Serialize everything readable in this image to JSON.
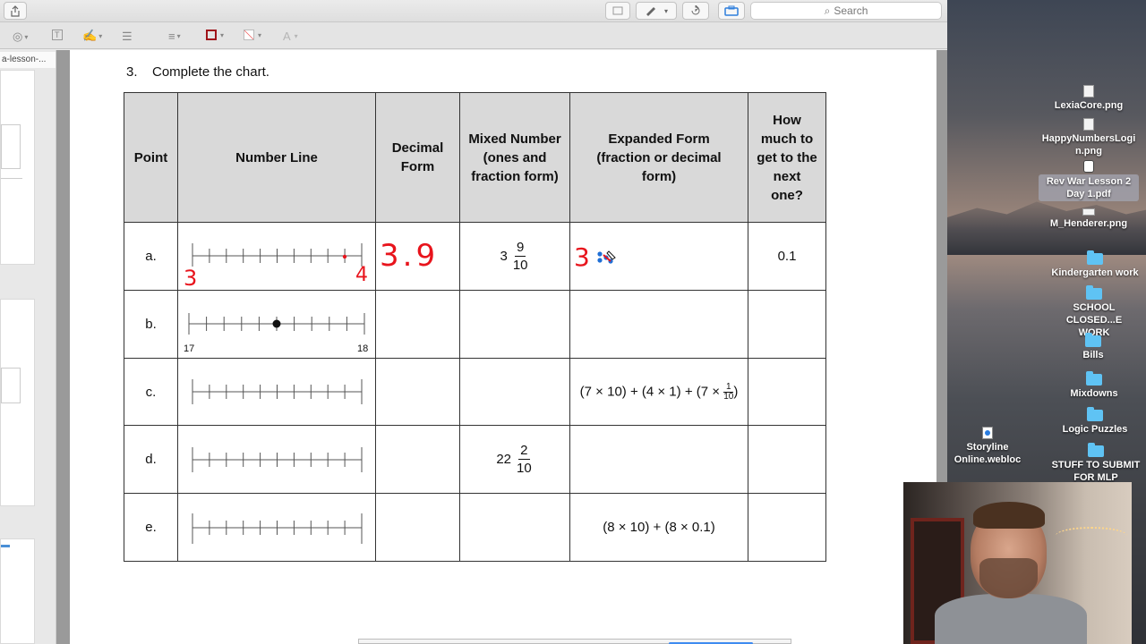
{
  "toolbar": {
    "search_placeholder": "Search"
  },
  "sidebar": {
    "tab_label": "a-lesson-..."
  },
  "document": {
    "question_number": "3.",
    "question_text": "Complete the chart.",
    "headers": {
      "point": "Point",
      "number_line": "Number Line",
      "decimal_form": "Decimal Form",
      "mixed_number": "Mixed Number (ones and fraction form)",
      "expanded_form": "Expanded Form (fraction or decimal form)",
      "next": "How much to get to the next one?"
    },
    "rows": [
      {
        "point": "a.",
        "mixed_whole": "3",
        "mixed_num": "9",
        "mixed_den": "10",
        "next": "0.1",
        "handwritten_decimal": "3.9",
        "handwritten_left": "3",
        "handwritten_right": "4",
        "handwritten_expanded": "3"
      },
      {
        "point": "b.",
        "nl_left_label": "17",
        "nl_right_label": "18"
      },
      {
        "point": "c.",
        "expanded_text": "(7 × 10) + (4 × 1) + (7 × ",
        "expanded_frac_num": "1",
        "expanded_frac_den": "10",
        "expanded_close": ")"
      },
      {
        "point": "d.",
        "mixed_whole": "22",
        "mixed_num": "2",
        "mixed_den": "10"
      },
      {
        "point": "e.",
        "expanded_text": "(8 × 10) + (8 × 0.1)"
      }
    ]
  },
  "desktop": {
    "items": [
      {
        "label": "LexiaCore.png",
        "icon": "file-icon"
      },
      {
        "label": "HappyNumbersLogin.png",
        "icon": "file-icon"
      },
      {
        "label": "Rev War Lesson 2 Day 1.pdf",
        "icon": "file-icon"
      },
      {
        "label": "M_Henderer.png",
        "icon": "file-icon"
      },
      {
        "label": "Kindergarten work",
        "icon": "folder-icon"
      },
      {
        "label": "SCHOOL CLOSED...E WORK",
        "icon": "folder-icon"
      },
      {
        "label": "Bills",
        "icon": "folder-icon"
      },
      {
        "label": "Mixdowns",
        "icon": "folder-icon"
      },
      {
        "label": "Logic Puzzles",
        "icon": "folder-icon"
      },
      {
        "label": "Storyline Online.webloc",
        "icon": "webloc-icon"
      },
      {
        "label": "STUFF TO SUBMIT FOR MLP",
        "icon": "folder-icon"
      }
    ]
  },
  "colors": {
    "ink_red": "#e8141c",
    "header_gray": "#d9d9d9",
    "folder_blue": "#5fc3f4"
  }
}
